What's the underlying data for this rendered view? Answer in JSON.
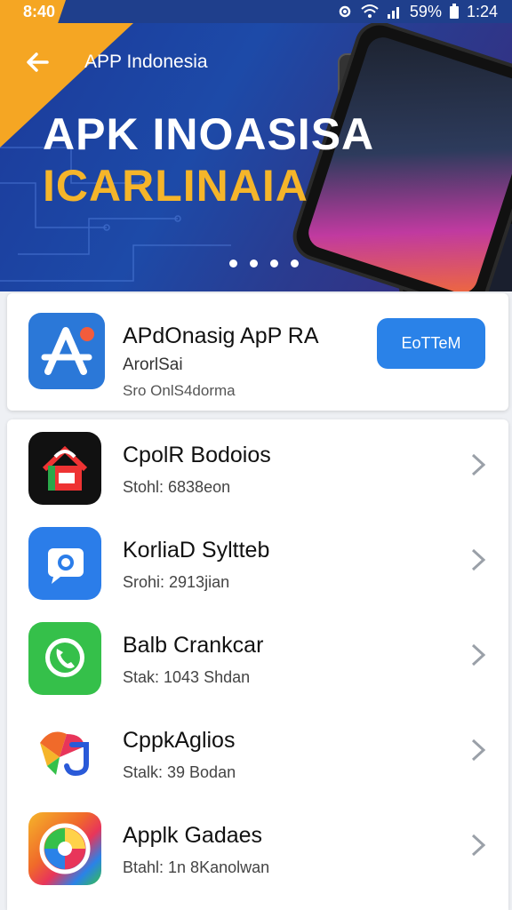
{
  "status_bar": {
    "time": "8:40",
    "battery": "59%",
    "clock": "1:24"
  },
  "hero": {
    "nav_title": "APP Indonesia",
    "headline_line1": "APK INOASISA",
    "headline_line2": "ICARLINAIA",
    "slide_count": 4
  },
  "featured": {
    "title": "APdOnasig ApP RA",
    "subtitle": "ArorlSai",
    "meta": "Sro OnlS4dorma",
    "button_label": "EoTTeM",
    "icon": "app-store-icon",
    "accent": "#2a82e8"
  },
  "apps": [
    {
      "title": "CpolR Bodoios",
      "meta": "Stohl: 6838eon",
      "icon": "home-icon"
    },
    {
      "title": "KorliaD Syltteb",
      "meta": "Srohi: 2913jian",
      "icon": "chat-camera-icon"
    },
    {
      "title": "Balb Crankcar",
      "meta": "Stak: 1043 Shdan",
      "icon": "phone-icon"
    },
    {
      "title": "CppkAglios",
      "meta": "Stalk: 39 Bodan",
      "icon": "colorful-j-icon"
    },
    {
      "title": "Applk Gadaes",
      "meta": "Btahl: 1n 8Kanolwan",
      "icon": "rainbow-circle-icon"
    }
  ],
  "colors": {
    "brand_blue": "#1f3f8c",
    "accent_orange": "#f5a623",
    "button_blue": "#2a82e8"
  }
}
